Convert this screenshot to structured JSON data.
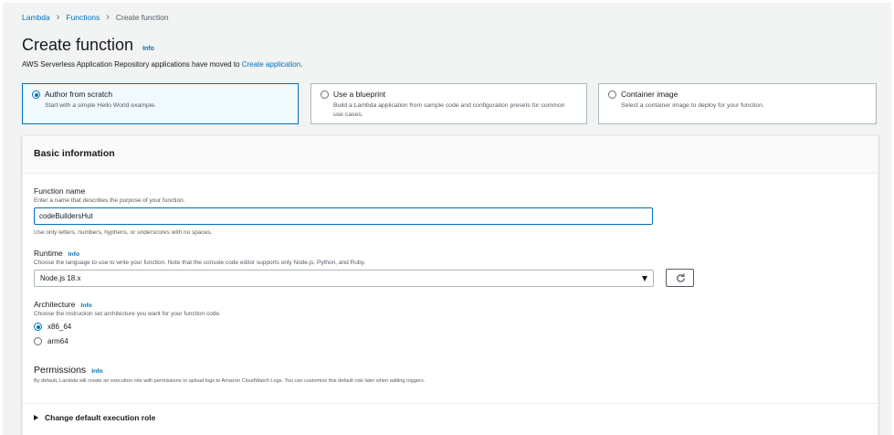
{
  "breadcrumb": {
    "items": [
      "Lambda",
      "Functions"
    ],
    "current": "Create function"
  },
  "title": "Create function",
  "title_info": "Info",
  "notice": {
    "text": "AWS Serverless Application Repository applications have moved to ",
    "link": "Create application",
    "suffix": "."
  },
  "options": [
    {
      "title": "Author from scratch",
      "desc": "Start with a simple Hello World example.",
      "selected": true
    },
    {
      "title": "Use a blueprint",
      "desc": "Build a Lambda application from sample code and configuration presets for common use cases.",
      "selected": false
    },
    {
      "title": "Container image",
      "desc": "Select a container image to deploy for your function.",
      "selected": false
    }
  ],
  "basic": {
    "title": "Basic information",
    "function_name": {
      "label": "Function name",
      "desc": "Enter a name that describes the purpose of your function.",
      "value": "codeBuildersHut",
      "constraint": "Use only letters, numbers, hyphens, or underscores with no spaces."
    },
    "runtime": {
      "label": "Runtime",
      "info": "Info",
      "desc": "Choose the language to use to write your function. Note that the console code editor supports only Node.js, Python, and Ruby.",
      "value": "Node.js 18.x"
    },
    "architecture": {
      "label": "Architecture",
      "info": "Info",
      "desc": "Choose the instruction set architecture you want for your function code.",
      "options": [
        "x86_64",
        "arm64"
      ],
      "selected": "x86_64"
    },
    "permissions": {
      "title": "Permissions",
      "info": "Info",
      "desc": "By default, Lambda will create an execution role with permissions to upload logs to Amazon CloudWatch Logs. You can customize this default role later when adding triggers."
    },
    "expander_label": "Change default execution role"
  },
  "colors": {
    "accent": "#0073bb",
    "selected_bg": "#f1faff",
    "page_bg": "#f2f3f3"
  }
}
